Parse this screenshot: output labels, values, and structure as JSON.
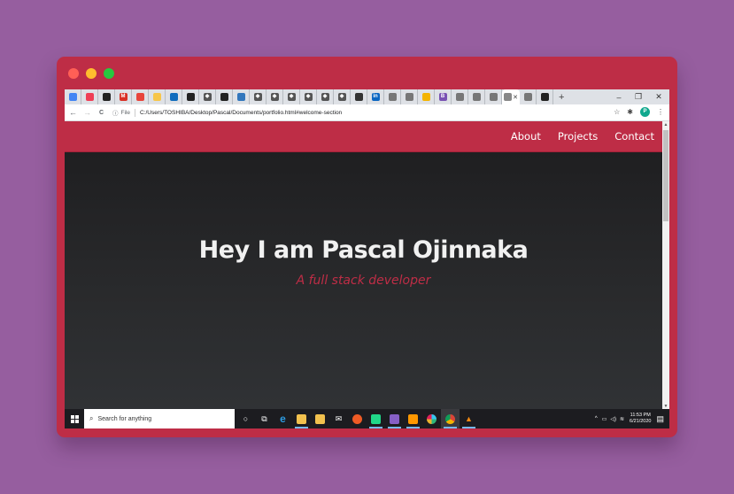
{
  "window": {
    "colors": {
      "frame": "#be2d46",
      "background": "#965e9f"
    },
    "traffic_lights": [
      {
        "name": "close",
        "color": "#ff5f56"
      },
      {
        "name": "minimize",
        "color": "#ffbd2e"
      },
      {
        "name": "maximize",
        "color": "#27c93f"
      }
    ]
  },
  "browser": {
    "tabs": [
      {
        "icon": "docs-icon",
        "glyph": "",
        "color": "#4285f4"
      },
      {
        "icon": "pocket-icon",
        "glyph": "",
        "color": "#ef3f56"
      },
      {
        "icon": "github-icon",
        "glyph": "",
        "color": "#222222"
      },
      {
        "icon": "gmail-icon",
        "glyph": "M",
        "color": "#d93025"
      },
      {
        "icon": "app-icon",
        "glyph": "",
        "color": "#e8453c"
      },
      {
        "icon": "folder-icon",
        "glyph": "",
        "color": "#f7c64a"
      },
      {
        "icon": "outlook-icon",
        "glyph": "",
        "color": "#0f6cbd"
      },
      {
        "icon": "dark-app-icon",
        "glyph": "",
        "color": "#222222"
      },
      {
        "icon": "diamond-icon",
        "glyph": "◆",
        "color": "#555555"
      },
      {
        "icon": "dark-app-icon",
        "glyph": "",
        "color": "#222222"
      },
      {
        "icon": "edge-icon",
        "glyph": "",
        "color": "#3277bc"
      },
      {
        "icon": "diamond-icon",
        "glyph": "◆",
        "color": "#555555"
      },
      {
        "icon": "diamond-icon",
        "glyph": "◆",
        "color": "#555555"
      },
      {
        "icon": "diamond-icon",
        "glyph": "◆",
        "color": "#555555"
      },
      {
        "icon": "diamond-icon",
        "glyph": "◆",
        "color": "#555555"
      },
      {
        "icon": "diamond-icon",
        "glyph": "◆",
        "color": "#555555"
      },
      {
        "icon": "diamond-icon",
        "glyph": "◆",
        "color": "#555555"
      },
      {
        "icon": "news-icon",
        "glyph": "",
        "color": "#333333"
      },
      {
        "icon": "linkedin-icon",
        "glyph": "in",
        "color": "#0a66c2"
      },
      {
        "icon": "globe-icon",
        "glyph": "",
        "color": "#777777"
      },
      {
        "icon": "globe-icon",
        "glyph": "",
        "color": "#777777"
      },
      {
        "icon": "keep-icon",
        "glyph": "",
        "color": "#f4b400"
      },
      {
        "icon": "bootstrap-icon",
        "glyph": "B",
        "color": "#7952b3"
      },
      {
        "icon": "globe-icon",
        "glyph": "",
        "color": "#777777"
      },
      {
        "icon": "globe-icon",
        "glyph": "",
        "color": "#777777"
      },
      {
        "icon": "globe-icon",
        "glyph": "",
        "color": "#777777"
      },
      {
        "icon": "active-tab-icon",
        "glyph": "",
        "color": "#888888",
        "active": true
      },
      {
        "icon": "globe-icon",
        "glyph": "",
        "color": "#777777"
      },
      {
        "icon": "dark-app-icon",
        "glyph": "",
        "color": "#222222"
      }
    ],
    "window_controls": {
      "minimize": "–",
      "restore": "❐",
      "close": "✕"
    },
    "toolbar": {
      "back": "←",
      "forward": "→",
      "reload": "C",
      "info": "ⓘ",
      "protocol": "File",
      "url": "C:/Users/TOSHIBA/Desktop/Pascal/Documents/portfolio.html#welcome-section",
      "star": "☆",
      "profile": "P",
      "menu": "⋮"
    }
  },
  "site": {
    "nav": [
      "About",
      "Projects",
      "Contact"
    ],
    "hero": {
      "title": "Hey I am Pascal Ojinnaka",
      "subtitle": "A full stack developer"
    },
    "colors": {
      "accent": "#be2d46",
      "hero_bg": "#252628"
    }
  },
  "taskbar": {
    "search_placeholder": "Search for anything",
    "apps": [
      {
        "icon": "cortana-icon",
        "glyph": "○",
        "color": "transparent"
      },
      {
        "icon": "task-view-icon",
        "glyph": "⧉",
        "color": "transparent"
      },
      {
        "icon": "edge-icon",
        "glyph": "e",
        "color": "#0078d7"
      },
      {
        "icon": "file-explorer-icon",
        "glyph": "",
        "color": "#f2c14e",
        "open": true
      },
      {
        "icon": "store-icon",
        "glyph": "",
        "color": "#f2c14e"
      },
      {
        "icon": "mail-icon",
        "glyph": "✉",
        "color": "transparent"
      },
      {
        "icon": "postman-icon",
        "glyph": "",
        "color": "#ef5b25"
      },
      {
        "icon": "pycharm-icon",
        "glyph": "",
        "color": "#21d789",
        "open": true
      },
      {
        "icon": "visual-studio-icon",
        "glyph": "",
        "color": "#865fc5",
        "open": true
      },
      {
        "icon": "sublime-icon",
        "glyph": "",
        "color": "#ff9800",
        "open": true
      },
      {
        "icon": "slack-icon",
        "glyph": "",
        "color": "#e01e5a"
      },
      {
        "icon": "chrome-icon",
        "glyph": "",
        "color": "#db4437",
        "open": true,
        "active": true
      },
      {
        "icon": "vlc-icon",
        "glyph": "▲",
        "color": "transparent",
        "open": true
      }
    ],
    "tray": {
      "chevron": "^",
      "time": "11:53 PM",
      "date": "6/21/2020",
      "notifications": "▤"
    }
  }
}
